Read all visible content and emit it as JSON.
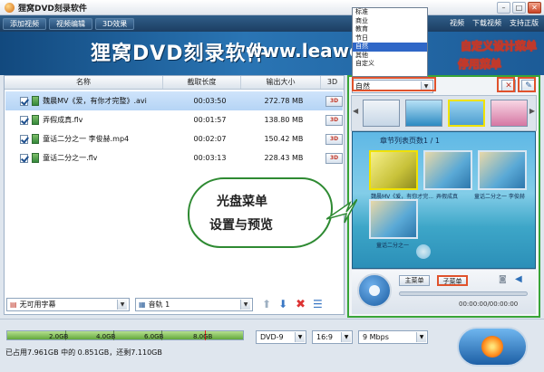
{
  "window": {
    "title": "狸窝DVD刻录软件"
  },
  "nav": {
    "tabs": [
      "添加视频",
      "视频编辑",
      "3D效果"
    ],
    "links": [
      "视频",
      "下载视频",
      "支持正版"
    ]
  },
  "banner": {
    "brand": "狸窝DVD刻录软件",
    "url": "www.leawo.cn"
  },
  "table": {
    "headers": [
      "名称",
      "截取长度",
      "输出大小",
      "3D"
    ],
    "rows": [
      {
        "name": "魏晨MV《爱，有你才完整》.avi",
        "duration": "00:03:50",
        "size": "272.78 MB"
      },
      {
        "name": "弄假成真.flv",
        "duration": "00:01:57",
        "size": "138.80 MB"
      },
      {
        "name": "童话二分之一 李俊赫.mp4",
        "duration": "00:02:07",
        "size": "150.42 MB"
      },
      {
        "name": "童话二分之一.flv",
        "duration": "00:03:13",
        "size": "228.43 MB"
      }
    ]
  },
  "tools": {
    "subtitle": "无可用字幕",
    "audio": "音轨 1"
  },
  "menu": {
    "options": [
      "标准",
      "商业",
      "教育",
      "节日",
      "自然",
      "其他",
      "自定义"
    ],
    "selected": "自然",
    "preview_title": "章节列表页数1 / 1",
    "captions": [
      "魏晨MV《爱，有你才完...",
      "弄假成真",
      "童话二分之一 李俊赫",
      "童话二分之一"
    ],
    "main_menu_btn": "主菜单",
    "sub_menu_btn": "子菜单",
    "time": "00:00:00/00:00:00"
  },
  "annotations": {
    "custom_design": "自定义设计菜单",
    "disable_menu": "停用菜单",
    "bubble_line1": "光盘菜单",
    "bubble_line2": "设置与预览"
  },
  "disk": {
    "ticks": [
      "2.0GB",
      "4.0GB",
      "6.0GB",
      "8.0GB"
    ],
    "usage": "已占用7.961GB 中的 0.851GB，还剩7.110GB",
    "used_fraction": 1.0
  },
  "output": {
    "disc": "DVD-9",
    "aspect": "16:9",
    "bitrate": "9 Mbps"
  }
}
